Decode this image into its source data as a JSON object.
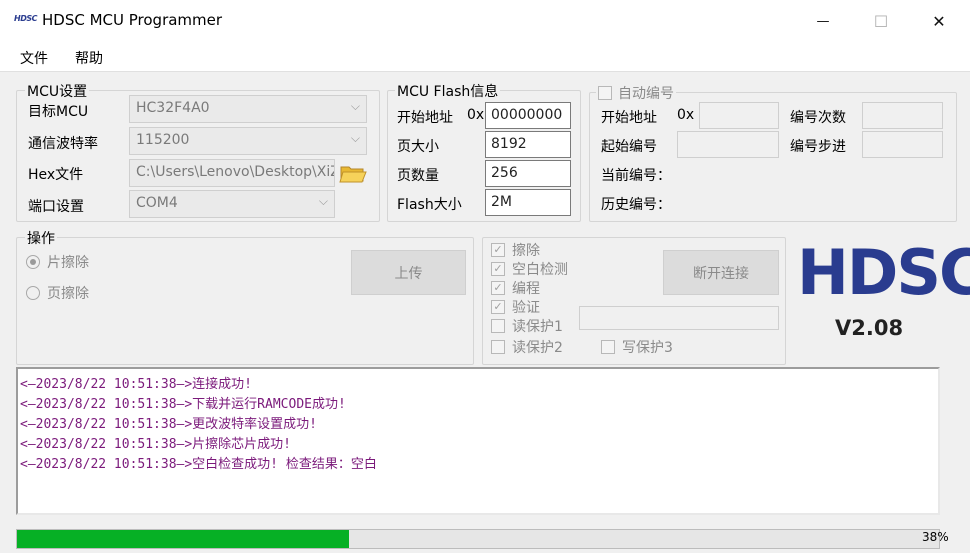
{
  "window": {
    "title": "HDSC MCU Programmer",
    "icon_text": "HDSC",
    "controls": {
      "minimize": "—",
      "maximize": "☐",
      "close": "✕"
    }
  },
  "menu": [
    "文件",
    "帮助"
  ],
  "mcu_settings": {
    "title": "MCU设置",
    "target_label": "目标MCU",
    "target_value": "HC32F4A0",
    "baud_label": "通信波特率",
    "baud_value": "115200",
    "hex_label": "Hex文件",
    "hex_value": "C:\\Users\\Lenovo\\Desktop\\XiZ",
    "port_label": "端口设置",
    "port_value": "COM4"
  },
  "flash_info": {
    "title": "MCU Flash信息",
    "start_addr_label": "开始地址",
    "start_addr_prefix": "0x",
    "start_addr_value": "00000000",
    "page_size_label": "页大小",
    "page_size_value": "8192",
    "page_count_label": "页数量",
    "page_count_value": "256",
    "flash_size_label": "Flash大小",
    "flash_size_value": "2M"
  },
  "auto_number": {
    "title": "自动编号",
    "start_addr_label": "开始地址",
    "start_addr_prefix": "0x",
    "count_label": "编号次数",
    "start_num_label": "起始编号",
    "step_label": "编号步进",
    "current_label": "当前编号：",
    "history_label": "历史编号："
  },
  "operations": {
    "title": "操作",
    "chip_erase": "片擦除",
    "page_erase": "页擦除",
    "upload_button": "上传",
    "options": [
      "擦除",
      "空白检测",
      "编程",
      "验证",
      "读保护1",
      "读保护2",
      "写保护3"
    ],
    "disconnect_button": "断开连接"
  },
  "brand": {
    "logo": "HDSC",
    "version": "V2.08"
  },
  "log": [
    "<—2023/8/22 10:51:38—>连接成功!",
    "<—2023/8/22 10:51:38—>下载并运行RAMCODE成功!",
    "<—2023/8/22 10:51:38—>更改波特率设置成功!",
    "<—2023/8/22 10:51:38—>片擦除芯片成功!",
    "<—2023/8/22 10:51:38—>空白检查成功! 检查结果：空白"
  ],
  "progress": {
    "percent_text": "38%",
    "value": 0.36
  },
  "colors": {
    "log_text": "#7b1a7b",
    "progress": "#06b025",
    "logo": "#2a3c8f"
  }
}
